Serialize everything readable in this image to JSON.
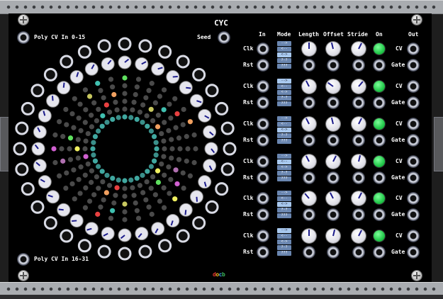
{
  "module": {
    "title": "CYC",
    "brand_letters": [
      "d",
      "o",
      "c",
      "b"
    ],
    "poly_in_low_label": "Poly CV In 0-15",
    "poly_in_high_label": "Poly CV In 16-31",
    "seed_label": "Seed"
  },
  "columns": {
    "in": "In",
    "mode": "Mode",
    "length": "Length",
    "offset": "Offset",
    "stride": "Stride",
    "on": "On",
    "out": "Out"
  },
  "row_labels": {
    "clk": "Clk",
    "rst": "Rst",
    "cv": "CV",
    "gate": "Gate"
  },
  "mode_options": [
    "-->",
    "<--",
    "<->",
    "?-?",
    "???"
  ],
  "channels": [
    {
      "mode_selected": 2,
      "length": 0.5,
      "offset": 0.45,
      "stride": 0.6,
      "on": true
    },
    {
      "mode_selected": 0,
      "length": 0.4,
      "offset": 0.3,
      "stride": 0.65,
      "on": true
    },
    {
      "mode_selected": 2,
      "length": 0.4,
      "offset": 0.45,
      "stride": 0.6,
      "on": true
    },
    {
      "mode_selected": 1,
      "length": 0.4,
      "offset": 0.6,
      "stride": 0.55,
      "on": true
    },
    {
      "mode_selected": 2,
      "length": 0.35,
      "offset": 0.4,
      "stride": 0.6,
      "on": true
    },
    {
      "mode_selected": 0,
      "length": 0.5,
      "offset": 0.55,
      "stride": 0.6,
      "on": true
    }
  ],
  "ring_lights": {
    "accent_colors": [
      "#5fe05f",
      "#f0a060",
      "#f0f060",
      "#e84040",
      "#d060d0",
      "#40c0b0",
      "#b070b0",
      "#c8c860"
    ]
  }
}
